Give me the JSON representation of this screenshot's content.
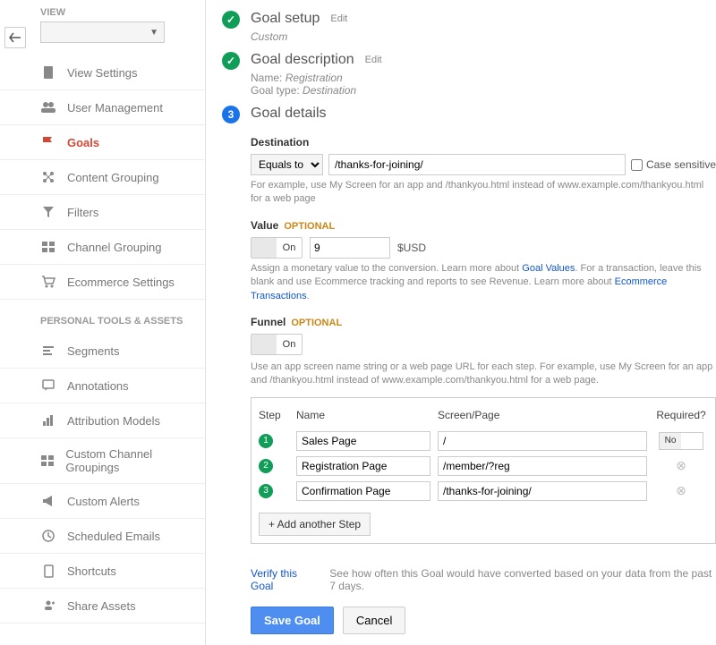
{
  "sidebar": {
    "view_label": "VIEW",
    "items": [
      {
        "label": "View Settings"
      },
      {
        "label": "User Management"
      },
      {
        "label": "Goals"
      },
      {
        "label": "Content Grouping"
      },
      {
        "label": "Filters"
      },
      {
        "label": "Channel Grouping"
      },
      {
        "label": "Ecommerce Settings"
      }
    ],
    "section2_label": "PERSONAL TOOLS & ASSETS",
    "items2": [
      {
        "label": "Segments"
      },
      {
        "label": "Annotations"
      },
      {
        "label": "Attribution Models"
      },
      {
        "label": "Custom Channel Groupings"
      },
      {
        "label": "Custom Alerts"
      },
      {
        "label": "Scheduled Emails"
      },
      {
        "label": "Shortcuts"
      },
      {
        "label": "Share Assets"
      }
    ]
  },
  "steps": {
    "setup": {
      "title": "Goal setup",
      "edit": "Edit",
      "sub": "Custom"
    },
    "desc": {
      "title": "Goal description",
      "edit": "Edit",
      "name_lbl": "Name:",
      "name": "Registration",
      "type_lbl": "Goal type:",
      "type": "Destination"
    },
    "details": {
      "title": "Goal details",
      "num": "3"
    }
  },
  "destination": {
    "label": "Destination",
    "operator": "Equals to",
    "value": "/thanks-for-joining/",
    "case_label": "Case sensitive",
    "help": "For example, use My Screen for an app and /thankyou.html instead of www.example.com/thankyou.html for a web page"
  },
  "value": {
    "label": "Value",
    "optional": "OPTIONAL",
    "toggle": "On",
    "amount": "9",
    "currency": "$USD",
    "help_pre": "Assign a monetary value to the conversion. Learn more about ",
    "link1": "Goal Values",
    "help_mid": ". For a transaction, leave this blank and use Ecommerce tracking and reports to see Revenue. Learn more about ",
    "link2": "Ecommerce Transactions",
    "help_post": "."
  },
  "funnel": {
    "label": "Funnel",
    "optional": "OPTIONAL",
    "toggle": "On",
    "help": "Use an app screen name string or a web page URL for each step. For example, use My Screen for an app and /thankyou.html instead of www.example.com/thankyou.html for a web page.",
    "cols": {
      "step": "Step",
      "name": "Name",
      "screen": "Screen/Page",
      "req": "Required?"
    },
    "rows": [
      {
        "n": "1",
        "name": "Sales Page",
        "screen": "/",
        "req": "No"
      },
      {
        "n": "2",
        "name": "Registration Page",
        "screen": "/member/?reg"
      },
      {
        "n": "3",
        "name": "Confirmation Page",
        "screen": "/thanks-for-joining/"
      }
    ],
    "add": "+ Add another Step"
  },
  "verify": {
    "link": "Verify this Goal",
    "text": "See how often this Goal would have converted based on your data from the past 7 days."
  },
  "buttons": {
    "save": "Save Goal",
    "cancel": "Cancel"
  }
}
